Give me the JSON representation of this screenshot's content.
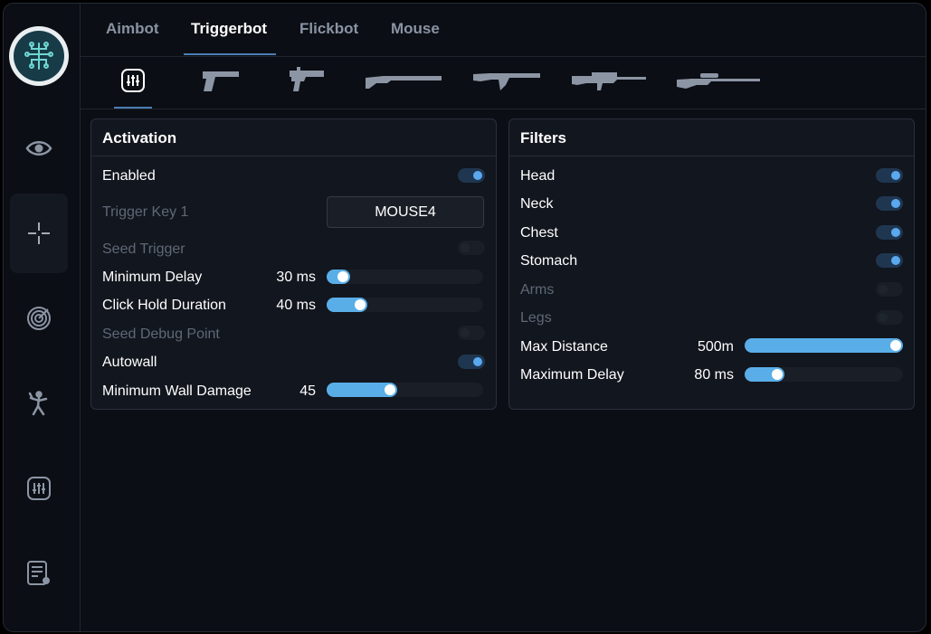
{
  "tabs": [
    {
      "label": "Aimbot",
      "active": false
    },
    {
      "label": "Triggerbot",
      "active": true
    },
    {
      "label": "Flickbot",
      "active": false
    },
    {
      "label": "Mouse",
      "active": false
    }
  ],
  "sidebar": {
    "items": [
      {
        "icon": "eye-icon"
      },
      {
        "icon": "crosshair-icon",
        "active": true
      },
      {
        "icon": "radar-icon"
      },
      {
        "icon": "stick-figure-icon"
      },
      {
        "icon": "sliders-icon"
      },
      {
        "icon": "script-icon"
      }
    ]
  },
  "weapon_tabs": [
    "sliders-icon",
    "pistol-icon",
    "smg-icon",
    "shotgun-icon",
    "rifle-icon",
    "machine-gun-icon",
    "sniper-icon"
  ],
  "activation": {
    "title": "Activation",
    "enabled_label": "Enabled",
    "trigger_key_label": "Trigger Key 1",
    "trigger_key_value": "MOUSE4",
    "seed_trigger_label": "Seed Trigger",
    "min_delay_label": "Minimum Delay",
    "min_delay_value": "30 ms",
    "min_delay_level": 0.15,
    "click_hold_label": "Click Hold Duration",
    "click_hold_value": "40 ms",
    "click_hold_level": 0.26,
    "seed_debug_label": "Seed Debug Point",
    "autowall_label": "Autowall",
    "min_wall_damage_label": "Minimum Wall Damage",
    "min_wall_damage_value": "45",
    "min_wall_damage_level": 0.45
  },
  "filters": {
    "title": "Filters",
    "head_label": "Head",
    "neck_label": "Neck",
    "chest_label": "Chest",
    "stomach_label": "Stomach",
    "arms_label": "Arms",
    "legs_label": "Legs",
    "max_distance_label": "Max Distance",
    "max_distance_value": "500m",
    "max_distance_level": 1.0,
    "max_delay_label": "Maximum Delay",
    "max_delay_value": "80 ms",
    "max_delay_level": 0.25
  },
  "colors": {
    "accent": "#5aa8ee",
    "background": "#0b0e14",
    "panel": "#12161e"
  }
}
